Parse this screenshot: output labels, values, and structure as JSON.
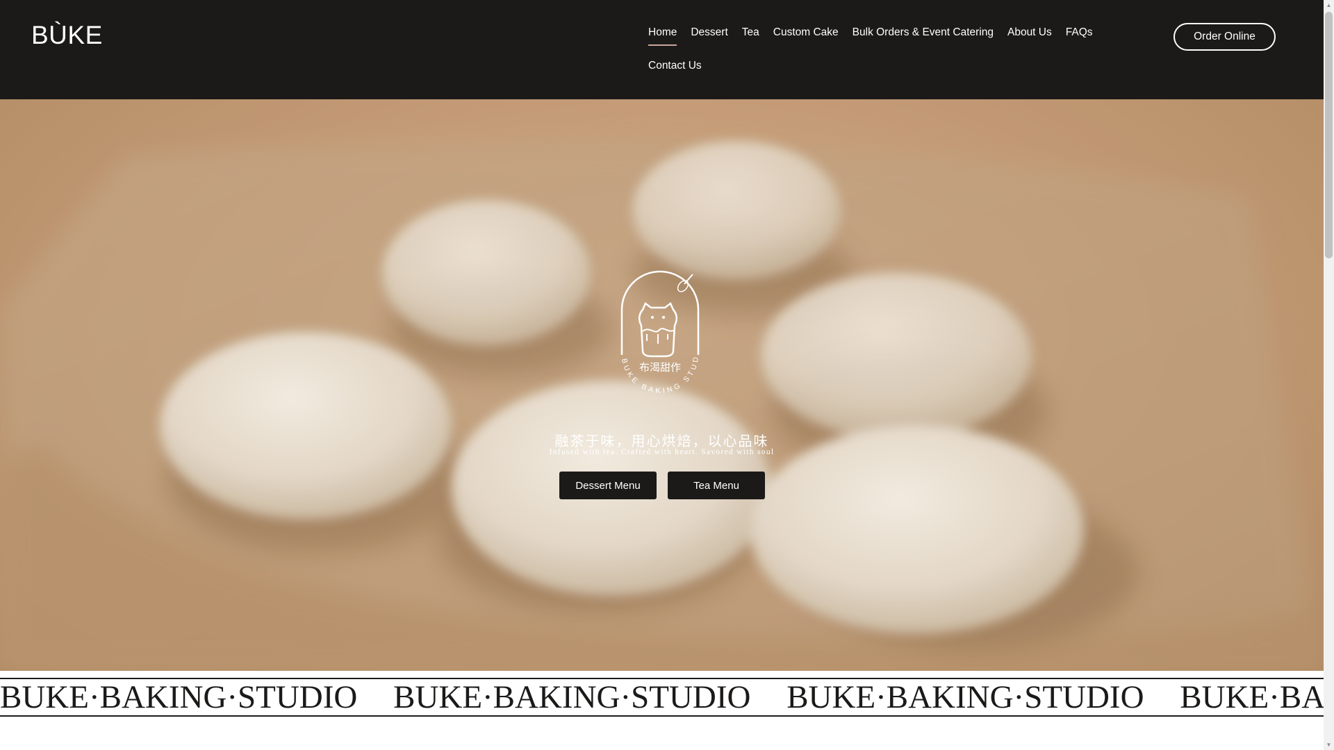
{
  "header": {
    "logo": "BÙKE",
    "nav": [
      {
        "label": "Home",
        "active": true
      },
      {
        "label": "Dessert"
      },
      {
        "label": "Tea"
      },
      {
        "label": "Custom Cake"
      },
      {
        "label": "Bulk Orders & Event Catering"
      },
      {
        "label": "About Us"
      },
      {
        "label": "FAQs"
      },
      {
        "label": "Contact Us"
      }
    ],
    "order_label": "Order Online",
    "colors": {
      "background": "#1b1a19",
      "text": "#ffffff",
      "active_underline": "#c9a79a"
    }
  },
  "hero": {
    "emblem": {
      "icon": "buke-baking-studio-emblem",
      "name_cn": "布渴甜作",
      "ring_text": "BUKE BAKING STUDIO"
    },
    "tagline_cn": "融茶于味，用心烘焙，以心品味",
    "tagline_en": "Infused with tea. Crafted with heart. Savored with soul",
    "buttons": {
      "dessert": "Dessert Menu",
      "tea": "Tea Menu"
    },
    "background_icon": "dough-buns-on-cloth-photo"
  },
  "marquee": {
    "items": [
      "BUKE·BAKING·STUDIO",
      "BUKE·BAKING·STUDIO",
      "BUKE·BAKING·STUDIO",
      "BUKE·BAKING·STUDIO"
    ]
  }
}
